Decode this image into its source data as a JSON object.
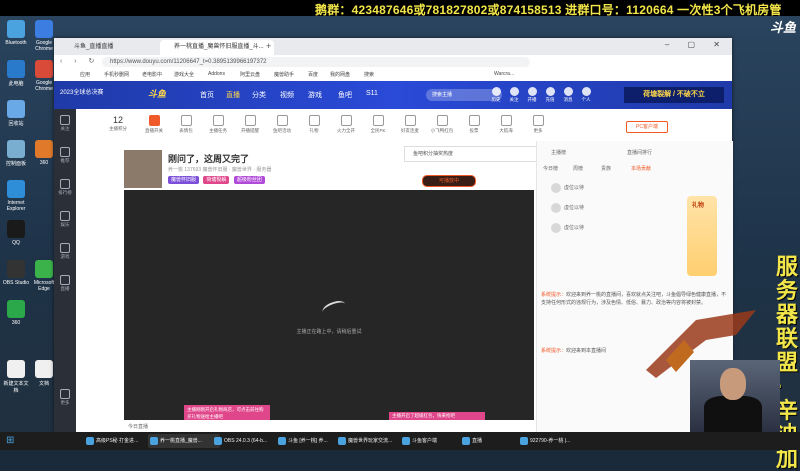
{
  "overlay": {
    "ticker": "鹅群：423487646或781827802或874158513    进群口号：1120664    一次性3个飞机房管",
    "brand": "斗鱼",
    "side_text": "服务器：联盟·辛迪加"
  },
  "desktop_icons": [
    "Bluetooth",
    "Google Chrome",
    "此电脑",
    "回收站",
    "控制面板",
    "Internet Explorer",
    "QQ",
    "OBS Studio",
    "360",
    "Microsoft Edge",
    "新建文本文档",
    "文档"
  ],
  "browser": {
    "tabs": [
      {
        "label": "斗鱼_直播直播"
      },
      {
        "label": "养一桃直播_魔兽怀旧服直播_斗..."
      }
    ],
    "url": "https://www.douyu.com/11206647_t=0.3895139966197372",
    "bookmarks": [
      "应用",
      "手机秒删网",
      "老电影中",
      "游戏大全",
      "Addons",
      "阿里云盘",
      "魔兽助手",
      "百度",
      "我的网盘",
      "搜索",
      "Warcra..."
    ]
  },
  "douyu": {
    "logo": "斗鱼",
    "promo": "2023全球总决赛",
    "nav": [
      "首页",
      "直播",
      "分类",
      "视频",
      "游戏",
      "鱼吧",
      "S11"
    ],
    "search_placeholder": "搜索主播",
    "nav_icons": [
      "历史",
      "关注",
      "开播",
      "充值",
      "消息",
      "个人"
    ],
    "banner_right": "荷塘裂解 / 不破不立",
    "rail": [
      "关注",
      "推荐",
      "排行榜",
      "娱乐",
      "游戏",
      "直播",
      "活动",
      "更多"
    ],
    "toolbar": {
      "level": "12",
      "level_label": "主播积分",
      "items": [
        "直播开关",
        "表情包",
        "主播任务",
        "开播提醒",
        "鱼吧活动",
        "礼物",
        "火力全开",
        "全民PK",
        "好友连麦",
        "小飞鸭红包",
        "投票",
        "大航海",
        "更多"
      ],
      "pc_button": "PC客户端"
    },
    "streamer": {
      "title": "刚问了，这周又完了",
      "sub": "养一桃   137693   魔兽怀旧服 · 魔兽世界 · 服务器",
      "tags": [
        "魔兽怀旧服",
        "荷塘裂解",
        "超级粉丝团"
      ]
    },
    "popup_text": "鱼吧积分抽奖热度",
    "tag_orange": "可播放中",
    "player_msg": "主播正在路上中，请稍后重试",
    "player_footer": "今日直播",
    "toast1": "主播刚刚开启礼物商店，可点击前往购买礼物送给主播吧",
    "toast2": "主播开启了超级红包，快来抢吧",
    "right": {
      "tabs": [
        "主播榜",
        "直播间排行"
      ],
      "subtabs": [
        "今日榜",
        "周榜",
        "贵族",
        "本场贡献"
      ],
      "ranks": [
        "虚位以待",
        "虚位以待",
        "虚位以待"
      ],
      "chat": [
        {
          "sys": "系统提示：",
          "text": "欢迎来到养一桃的直播间，喜欢就点关注吧，斗鱼倡导绿色健康直播，不支持任何形式的违规行为，涉及色情、低俗、暴力、政治等内容将被封禁。"
        },
        {
          "sys": "系统提示：",
          "text": "欢迎来到本直播间"
        }
      ]
    },
    "gift_label": "礼物"
  },
  "taskbar": [
    "高级PS秘 打金进...",
    "养一桃直播_魔兽...",
    "OBS 24.0.3 (64-b...",
    "斗鱼 [养一桃] 养...",
    "魔兽世界玩家交流...",
    "斗鱼客户端",
    "直播",
    "922790-养一桃 |..."
  ]
}
